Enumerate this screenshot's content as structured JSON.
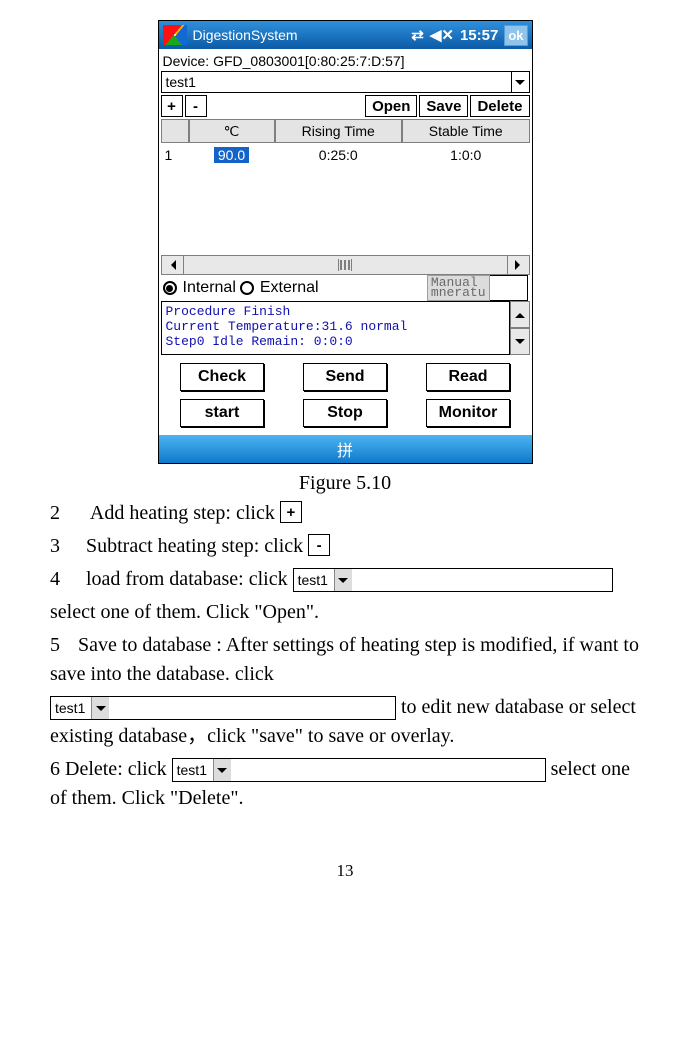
{
  "titlebar": {
    "app": "DigestionSystem",
    "time": "15:57",
    "ok": "ok"
  },
  "device_line": "Device: GFD_0803001[0:80:25:7:D:57]",
  "main_combo": "test1",
  "toolbar": {
    "plus": "+",
    "minus": "-",
    "open": "Open",
    "save": "Save",
    "delete": "Delete"
  },
  "headers": {
    "c": "℃",
    "rising": "Rising Time",
    "stable": "Stable Time"
  },
  "row": {
    "idx": "1",
    "c": "90.0",
    "rising": "0:25:0",
    "stable": "1:0:0"
  },
  "radio": {
    "internal": "Internal",
    "external": "External",
    "manual_top": "Manual",
    "manual_bottom": "mneratu"
  },
  "status": {
    "line1": "Procedure Finish",
    "line2": "Current Temperature:31.6 normal",
    "line3": "Step0 Idle Remain: 0:0:0"
  },
  "actions": {
    "check": "Check",
    "send": "Send",
    "read": "Read",
    "start": "start",
    "stop": "Stop",
    "monitor": "Monitor"
  },
  "ime": "拼",
  "caption": "Figure 5.10",
  "body": {
    "n2": "2",
    "t2": "Add heating step: click",
    "n3": "3",
    "t3": "Subtract heating step: click",
    "n4": "4",
    "t4a": "load from database: click",
    "t4b": "select one of them. Click \"Open\".",
    "n5": "5",
    "t5a": "Save to database : After settings of heating step is modified, if want to save into the database. click",
    "t5b": " to edit new database or select existing database，click \"save\" to save or overlay.",
    "n6": "6 Delete: click ",
    "t6b": " select one of them. Click \"Delete\".",
    "combo_label": "test1"
  },
  "pagenum": "13"
}
